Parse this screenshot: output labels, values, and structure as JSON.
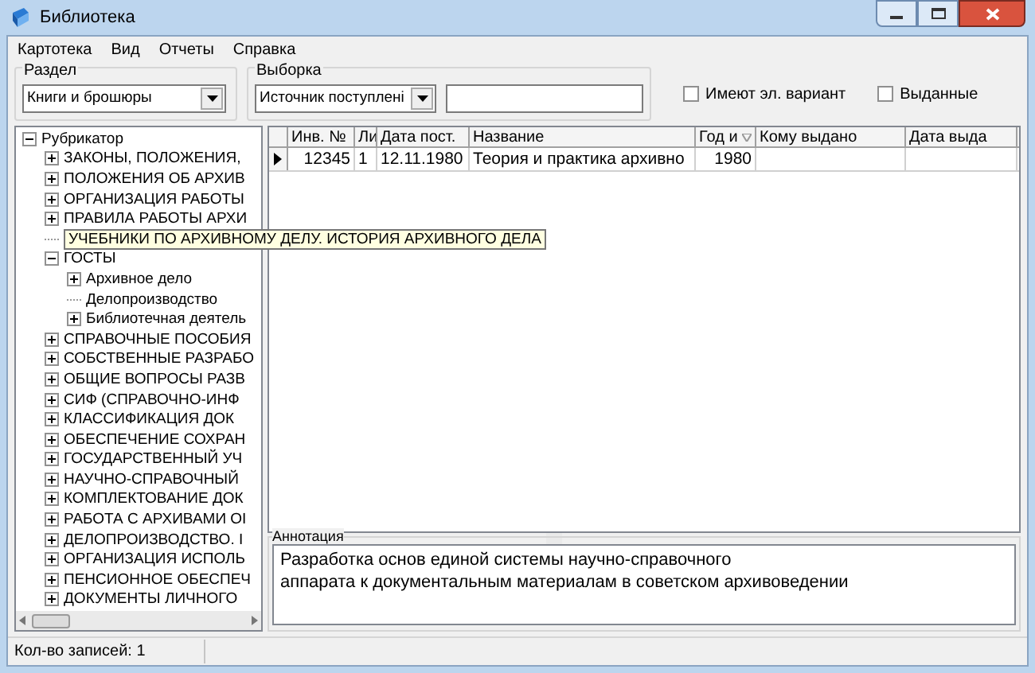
{
  "window": {
    "title": "Библиотека"
  },
  "menu": [
    "Картотека",
    "Вид",
    "Отчеты",
    "Справка"
  ],
  "section": {
    "label": "Раздел",
    "value": "Книги и брошюры"
  },
  "filter": {
    "label": "Выборка",
    "value": "Источник поступлені"
  },
  "checkboxes": [
    {
      "label": "Имеют эл. вариант",
      "checked": false
    },
    {
      "label": "Выданные",
      "checked": false
    }
  ],
  "tree": [
    {
      "label": "Рубрикатор",
      "expanded": true,
      "children": [
        {
          "label": "ЗАКОНЫ, ПОЛОЖЕНИЯ,",
          "expanded": false
        },
        {
          "label": "ПОЛОЖЕНИЯ ОБ АРХИВ",
          "expanded": false
        },
        {
          "label": "ОРГАНИЗАЦИЯ РАБОТЫ",
          "expanded": false
        },
        {
          "label": "ПРАВИЛА РАБОТЫ АРХИ",
          "expanded": false
        },
        {
          "label": "УЧЕБНИКИ ПО АРХИВНОМУ ДЕЛУ. ИСТОРИЯ АРХИВНОГО ДЕЛА",
          "hovered": true
        },
        {
          "label": "ГОСТЫ",
          "expanded": true,
          "children": [
            {
              "label": "Архивное дело",
              "expanded": false
            },
            {
              "label": "Делопроизводство"
            },
            {
              "label": "Библиотечная деятель",
              "expanded": false
            }
          ]
        },
        {
          "label": "СПРАВОЧНЫЕ ПОСОБИЯ",
          "expanded": false
        },
        {
          "label": "СОБСТВЕННЫЕ РАЗРАБО",
          "expanded": false
        },
        {
          "label": "ОБЩИЕ ВОПРОСЫ РАЗВ",
          "expanded": false
        },
        {
          "label": "СИФ (СПРАВОЧНО-ИНФ",
          "expanded": false
        },
        {
          "label": "КЛАССИФИКАЦИЯ ДОК",
          "expanded": false
        },
        {
          "label": "ОБЕСПЕЧЕНИЕ СОХРАН",
          "expanded": false
        },
        {
          "label": "ГОСУДАРСТВЕННЫЙ УЧ",
          "expanded": false
        },
        {
          "label": "НАУЧНО-СПРАВОЧНЫЙ",
          "expanded": false
        },
        {
          "label": "КОМПЛЕКТОВАНИЕ ДОК",
          "expanded": false
        },
        {
          "label": "РАБОТА С АРХИВАМИ ОІ",
          "expanded": false
        },
        {
          "label": "ДЕЛОПРОИЗВОДСТВО. І",
          "expanded": false
        },
        {
          "label": "ОРГАНИЗАЦИЯ ИСПОЛЬ",
          "expanded": false
        },
        {
          "label": "ПЕНСИОННОЕ ОБЕСПЕЧ",
          "expanded": false
        },
        {
          "label": "ДОКУМЕНТЫ ЛИЧНОГО",
          "expanded": false
        }
      ]
    }
  ],
  "table": {
    "columns": [
      "Инв. №",
      "Ли",
      "Дата пост.",
      "Название",
      "Год и",
      "Кому выдано",
      "Дата выда"
    ],
    "rows": [
      {
        "selected": true,
        "cells": [
          "12345",
          "1",
          "12.11.1980",
          "Теория и практика архивно",
          "1980",
          "",
          ""
        ]
      }
    ]
  },
  "annotation": {
    "label": "Аннотация",
    "lines": [
      "Разработка основ единой системы научно-справочного",
      "аппарата к документальным материалам в советском архивоведении"
    ]
  },
  "status_bar": {
    "text": "Кол-во записей: 1"
  }
}
